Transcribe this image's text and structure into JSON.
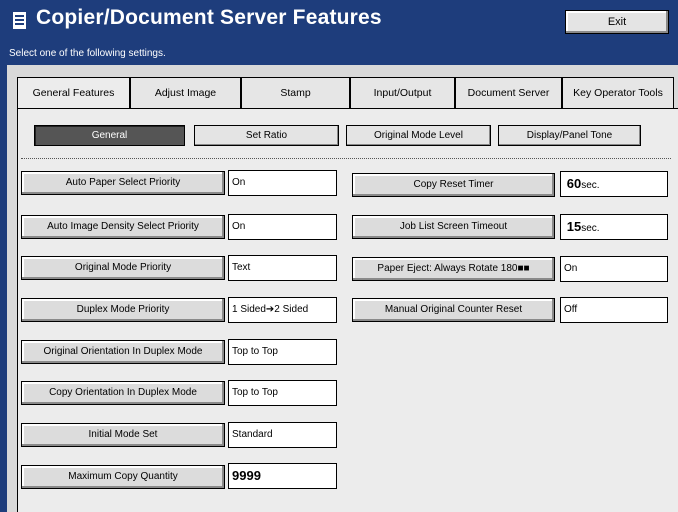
{
  "title": "Copier/Document Server Features",
  "exit_label": "Exit",
  "prompt": "Select one of the following settings.",
  "tabs": [
    {
      "label": "General Features"
    },
    {
      "label": "Adjust Image"
    },
    {
      "label": "Stamp"
    },
    {
      "label": "Input/Output"
    },
    {
      "label": "Document Server"
    },
    {
      "label": "Key Operator Tools"
    }
  ],
  "subtabs": [
    {
      "label": "General"
    },
    {
      "label": "Set Ratio"
    },
    {
      "label": "Original Mode Level"
    },
    {
      "label": "Display/Panel Tone"
    }
  ],
  "left_settings": [
    {
      "label": "Auto Paper Select Priority",
      "value": "On"
    },
    {
      "label": "Auto Image Density Select Priority",
      "value": "On"
    },
    {
      "label": "Original Mode Priority",
      "value": "Text"
    },
    {
      "label": "Duplex Mode Priority",
      "value": "1 Sided➔2 Sided"
    },
    {
      "label": "Original Orientation In Duplex Mode",
      "value": "Top to Top"
    },
    {
      "label": "Copy Orientation In Duplex Mode",
      "value": "Top to Top"
    },
    {
      "label": "Initial Mode Set",
      "value": "Standard"
    },
    {
      "label": "Maximum Copy Quantity",
      "value": "9999"
    }
  ],
  "right_settings": [
    {
      "label": "Copy Reset Timer",
      "value": "60",
      "unit": "sec."
    },
    {
      "label": "Job List Screen Timeout",
      "value": "15",
      "unit": "sec."
    },
    {
      "label": "Paper Eject: Always Rotate 180■■",
      "value": "On"
    },
    {
      "label": "Manual Original Counter Reset",
      "value": "Off"
    }
  ],
  "colors": {
    "title_bar": "#1e3d7c",
    "panel": "#d9d9d9",
    "active_subtab": "#555555"
  }
}
